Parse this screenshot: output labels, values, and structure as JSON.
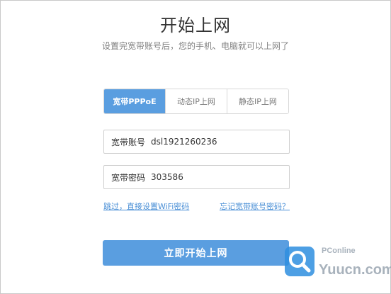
{
  "page": {
    "title": "开始上网",
    "subtitle": "设置完宽带账号后，您的手机、电脑就可以上网了"
  },
  "tabs": [
    {
      "label": "宽带PPPoE",
      "active": true
    },
    {
      "label": "动态IP上网",
      "active": false
    },
    {
      "label": "静态IP上网",
      "active": false
    }
  ],
  "form": {
    "account_label": "宽带账号",
    "account_value": "dsl1921260236",
    "password_label": "宽带密码",
    "password_value": "303586"
  },
  "links": {
    "skip_label": "跳过，直接设置WiFi密码",
    "forgot_label": "忘记宽带账号密码？"
  },
  "buttons": {
    "start_label": "立即开始上网"
  },
  "watermark": {
    "brand": "PConline",
    "site": "Yuucn.com"
  },
  "colors": {
    "accent": "#5a9ee0",
    "link": "#4a8fd6",
    "text": "#333333",
    "muted": "#808080"
  },
  "icons": {
    "watermark_logo": "magnifier-logo-icon"
  }
}
